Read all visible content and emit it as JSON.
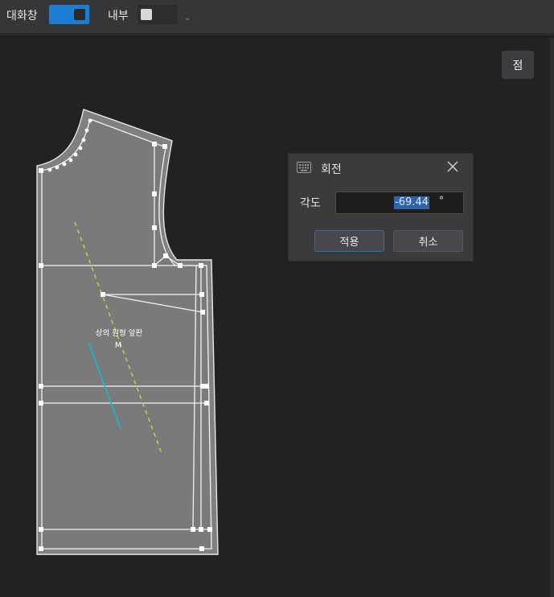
{
  "toolbar": {
    "dialog_label": "대화창",
    "dialog_toggle_on": true,
    "inner_label": "내부",
    "inner_toggle_on": false
  },
  "canvas": {
    "point_button_label": "점",
    "pattern_label_name": "상의 원형 앞판",
    "pattern_label_size": "M"
  },
  "rotate_dialog": {
    "icon": "keyboard-icon",
    "title": "회전",
    "angle_label": "각도",
    "angle_value": "-69.44",
    "angle_unit": "°",
    "apply_label": "적용",
    "cancel_label": "취소"
  },
  "colors": {
    "accent": "#1a7fd4",
    "pattern_fill": "#7a7a7a",
    "grainline": "#d4d23a",
    "cyan_line": "#1fb5c4"
  }
}
